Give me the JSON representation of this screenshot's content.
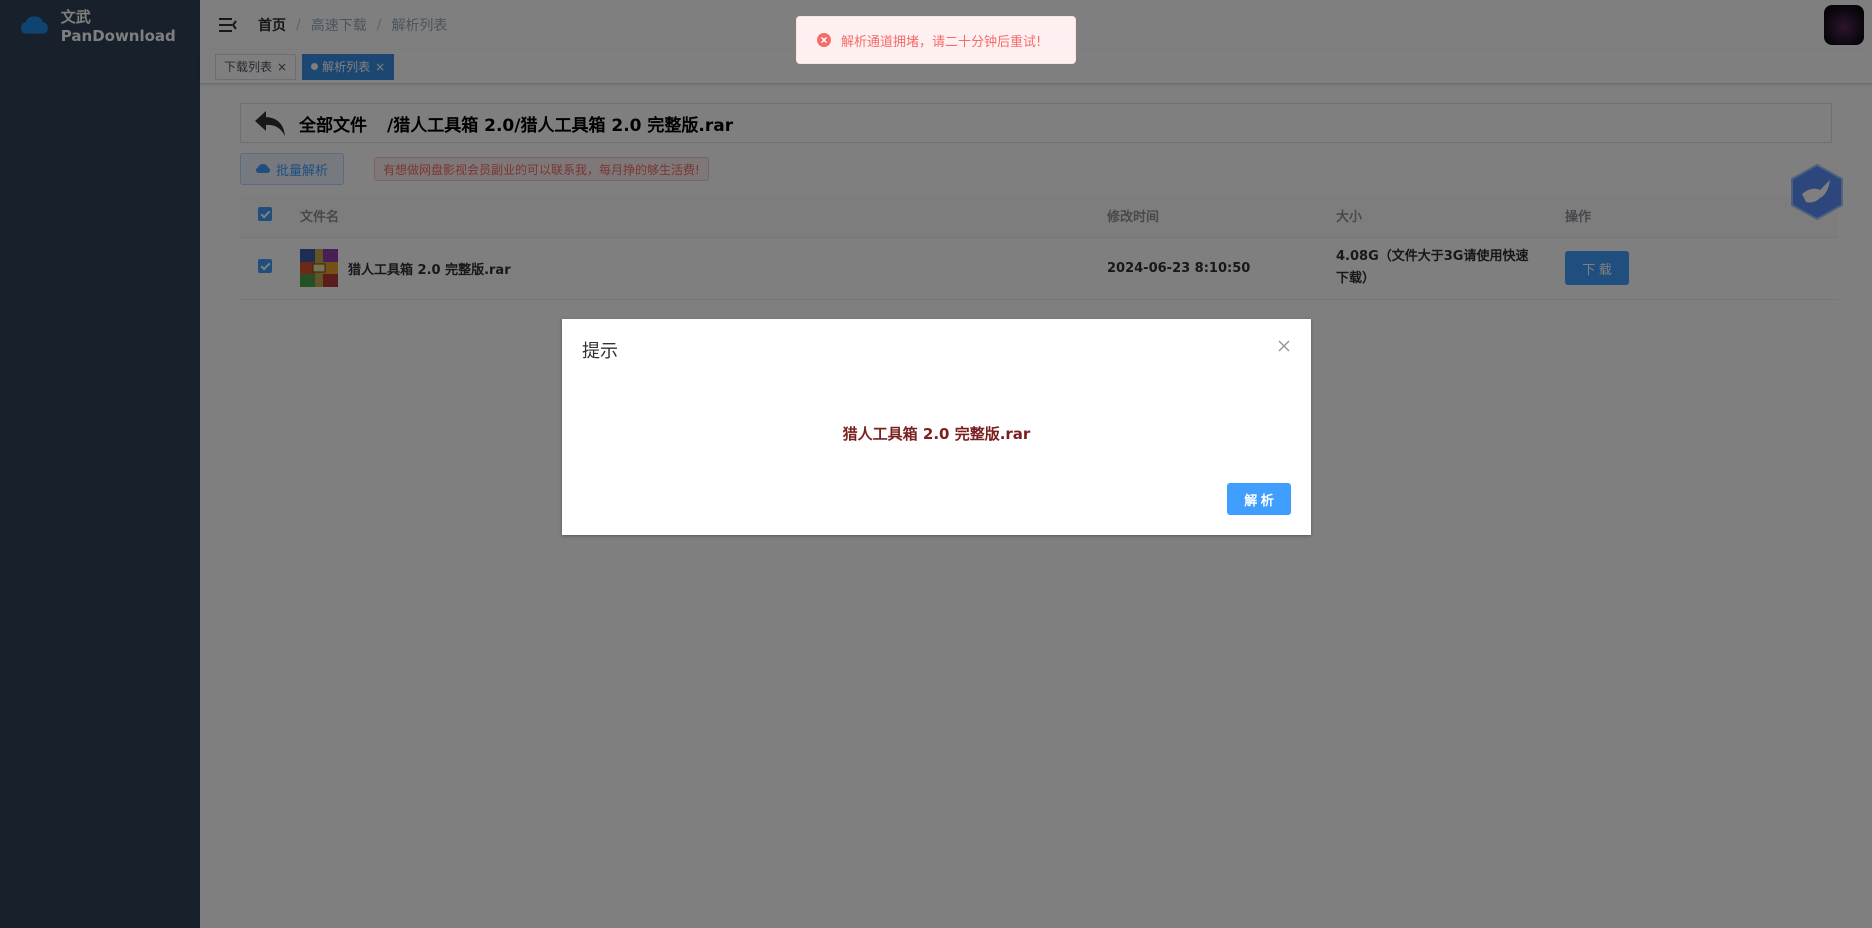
{
  "brand": {
    "name": "文武PanDownload"
  },
  "breadcrumb": {
    "home": "首页",
    "sep1": "/",
    "item1": "高速下载",
    "sep2": "/",
    "item2": "解析列表"
  },
  "tags": [
    {
      "label": "下载列表",
      "close": "×"
    },
    {
      "label": "解析列表",
      "close": "×"
    }
  ],
  "path": {
    "all": "全部文件",
    "current": "/猎人工具箱 2.0/猎人工具箱 2.0 完整版.rar"
  },
  "toolbar": {
    "batch_label": "批量解析",
    "notice": "有想做网盘影视会员副业的可以联系我，每月挣的够生活费!"
  },
  "table": {
    "headers": {
      "name": "文件名",
      "mtime": "修改时间",
      "size": "大小",
      "action": "操作"
    },
    "rows": [
      {
        "name": "猎人工具箱 2.0 完整版.rar",
        "mtime": "2024-06-23 8:10:50",
        "size_line1": "4.08G（文件大于3G请使用快速",
        "size_line2": "下载）",
        "action_label": "下 载"
      }
    ]
  },
  "dialog": {
    "title": "提示",
    "body": "猎人工具箱 2.0 完整版.rar",
    "button": "解 析"
  },
  "toast": {
    "text": "解析通道拥堵，请二十分钟后重试!"
  },
  "colors": {
    "sidebar": "#304156",
    "primary": "#409eff",
    "danger": "#f56c6c"
  },
  "icons": [
    "cloud-logo-icon",
    "hamburger-icon",
    "back-arrow-icon",
    "cloud-upload-icon",
    "rar-file-icon",
    "bird-float-icon",
    "close-icon",
    "error-circle-icon"
  ]
}
